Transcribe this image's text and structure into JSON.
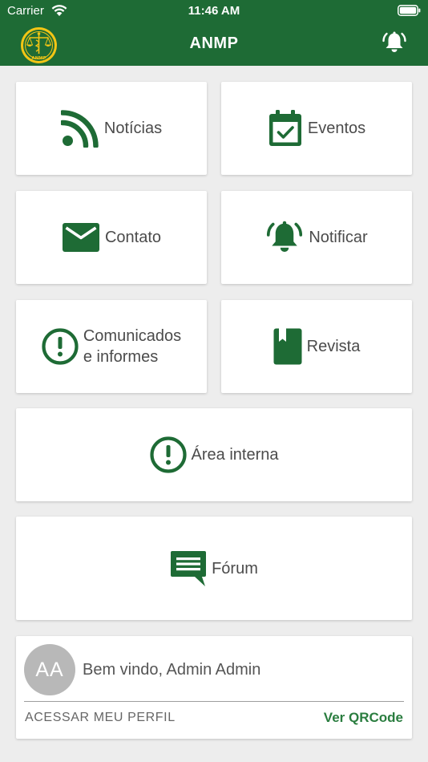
{
  "status_bar": {
    "carrier": "Carrier",
    "time": "11:46 AM"
  },
  "nav": {
    "title": "ANMP",
    "logo_text": "ANMP"
  },
  "tiles": {
    "noticias": {
      "label": "Notícias",
      "icon": "rss-icon"
    },
    "eventos": {
      "label": "Eventos",
      "icon": "calendar-check-icon"
    },
    "contato": {
      "label": "Contato",
      "icon": "envelope-icon"
    },
    "notificar": {
      "label": "Notificar",
      "icon": "bell-ringing-icon"
    },
    "comunicados": {
      "label": "Comunicados\ne informes",
      "icon": "alert-circle-icon"
    },
    "revista": {
      "label": "Revista",
      "icon": "book-icon"
    },
    "area_interna": {
      "label": "Área interna",
      "icon": "alert-circle-icon"
    },
    "forum": {
      "label": "Fórum",
      "icon": "forum-message-icon"
    }
  },
  "profile": {
    "initials": "AA",
    "welcome": "Bem vindo, Admin Admin",
    "profile_link": "ACESSAR MEU PERFIL",
    "qrcode_link": "Ver QRCode"
  },
  "colors": {
    "brand_green": "#1e6b35",
    "icon_green": "#1e6b35",
    "link_green": "#2a7d3f",
    "background": "#ededed",
    "avatar_gray": "#b8b8b8"
  }
}
